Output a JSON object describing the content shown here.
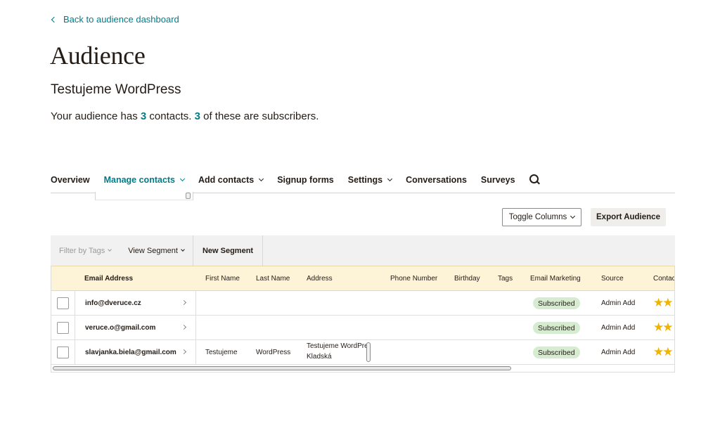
{
  "back_link": "Back to audience dashboard",
  "page_title": "Audience",
  "audience_name": "Testujeme WordPress",
  "summary": {
    "prefix": "Your audience has",
    "contacts_count": "3",
    "middle": "contacts.",
    "subscribers_count": "3",
    "suffix": "of these are subscribers."
  },
  "nav": {
    "overview": "Overview",
    "manage_contacts": "Manage contacts",
    "add_contacts": "Add contacts",
    "signup_forms": "Signup forms",
    "settings": "Settings",
    "conversations": "Conversations",
    "surveys": "Surveys",
    "search_icon": "search-icon"
  },
  "toolbar": {
    "toggle_columns": "Toggle Columns",
    "export_audience": "Export Audience"
  },
  "filter_bar": {
    "filter_by_tags": "Filter by Tags",
    "view_segment": "View Segment",
    "new_segment": "New Segment"
  },
  "table": {
    "headers": {
      "email": "Email Address",
      "first_name": "First Name",
      "last_name": "Last Name",
      "address": "Address",
      "phone": "Phone Number",
      "birthday": "Birthday",
      "tags": "Tags",
      "email_marketing": "Email Marketing",
      "source": "Source",
      "contact_rating": "Contac"
    },
    "rows": [
      {
        "email": "info@dveruce.cz",
        "first_name": "",
        "last_name": "",
        "address_line1": "",
        "address_line2": "",
        "email_marketing": "Subscribed",
        "source": "Admin Add",
        "rating_stars": "★★"
      },
      {
        "email": "veruce.o@gmail.com",
        "first_name": "",
        "last_name": "",
        "address_line1": "",
        "address_line2": "",
        "email_marketing": "Subscribed",
        "source": "Admin Add",
        "rating_stars": "★★"
      },
      {
        "email": "slavjanka.biela@gmail.com",
        "first_name": "Testujeme",
        "last_name": "WordPress",
        "address_line1": "Testujeme WordPre",
        "address_line2": "Kladská",
        "email_marketing": "Subscribed",
        "source": "Admin Add",
        "rating_stars": "★★"
      }
    ]
  },
  "colors": {
    "accent": "#007c89",
    "header_bg": "#fdf3d6",
    "badge_bg": "#d6ecd0",
    "star": "#f0b400"
  }
}
